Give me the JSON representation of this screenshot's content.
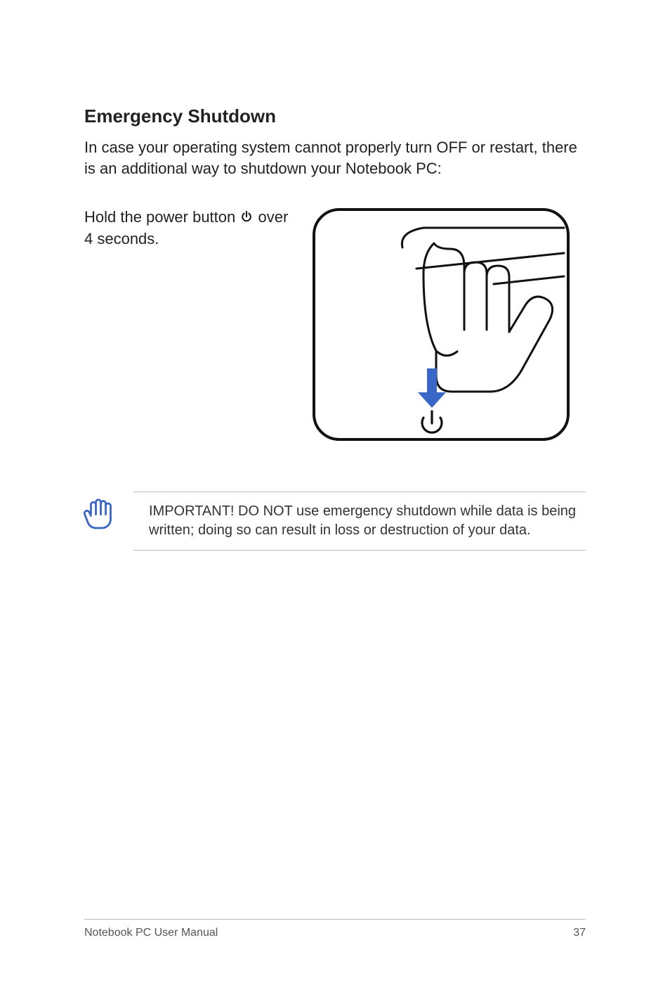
{
  "heading": "Emergency Shutdown",
  "intro": "In case your operating system cannot properly turn OFF or restart, there is an additional way to shutdown your Notebook PC:",
  "instruction": {
    "before": "Hold the power button ",
    "after": " over 4 seconds."
  },
  "note": "IMPORTANT!  DO NOT use emergency shutdown while data is being written; doing so can result in loss or destruction of your data.",
  "footer": {
    "title": "Notebook PC User Manual",
    "page": "37"
  }
}
